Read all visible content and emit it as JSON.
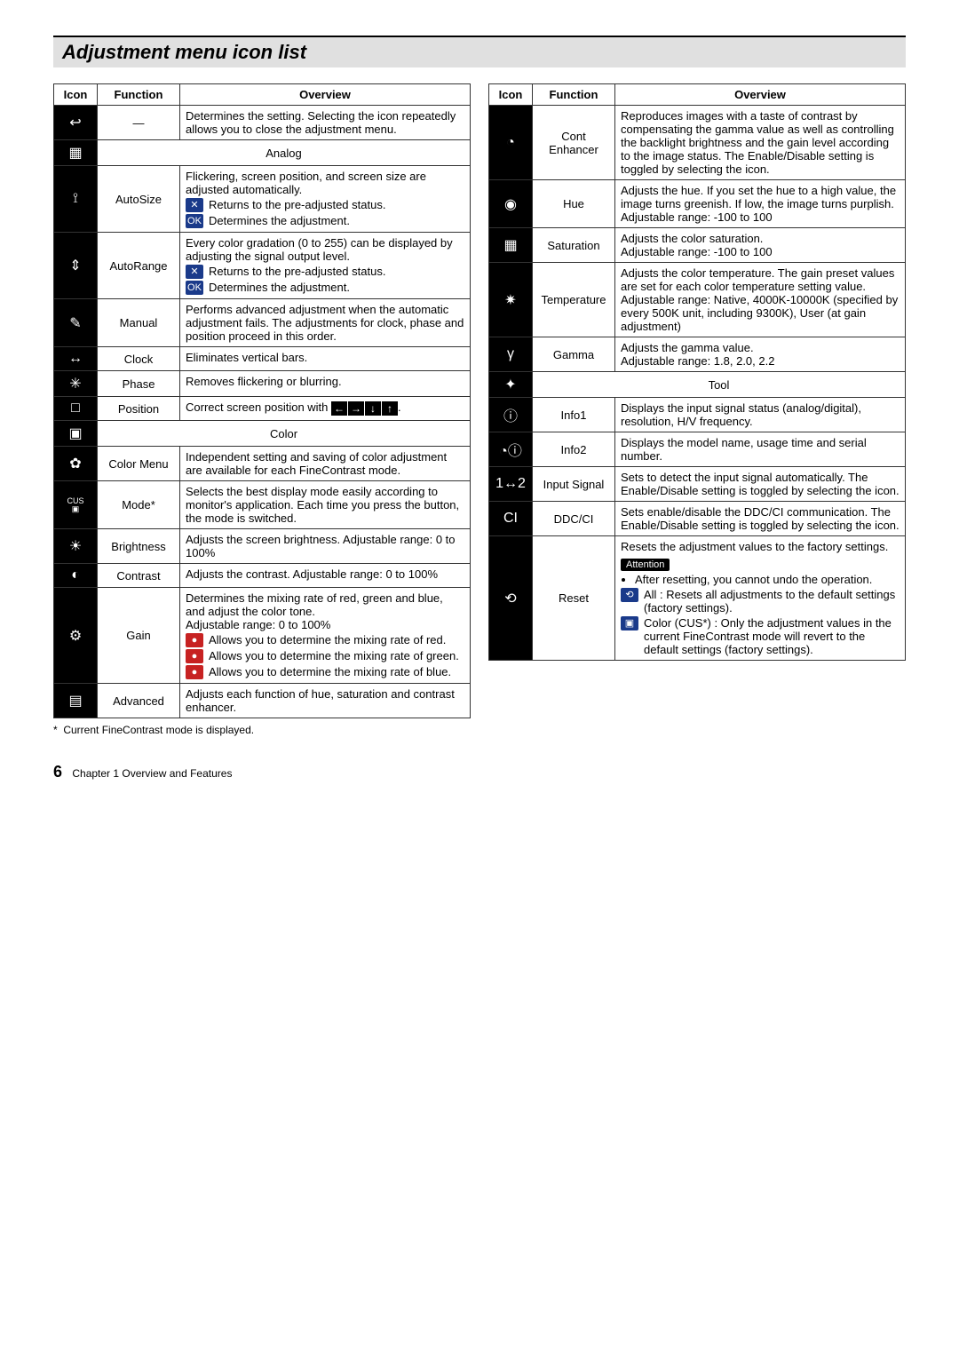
{
  "page": {
    "title": "Adjustment menu icon list",
    "footnote": "Current FineContrast mode is displayed.",
    "footer_page": "6",
    "footer_chapter": "Chapter 1  Overview and Features"
  },
  "headers": {
    "icon": "Icon",
    "function": "Function",
    "overview": "Overview"
  },
  "sections": {
    "analog": "Analog",
    "color": "Color",
    "tool": "Tool"
  },
  "left": [
    {
      "icon_glyph": "↩",
      "function": "—",
      "overview": "Determines the setting. Selecting the icon repeatedly allows you to close the adjustment menu."
    },
    {
      "section": "analog",
      "icon_glyph": "▦"
    },
    {
      "icon_glyph": "⟟",
      "function": "AutoSize",
      "overview": "Flickering, screen position, and screen size are adjusted automatically.",
      "sub": [
        {
          "icon": "✕",
          "cls": "darkblue",
          "text": "Returns to the pre-adjusted status."
        },
        {
          "icon": "OK",
          "cls": "darkblue",
          "text": "Determines the adjustment."
        }
      ]
    },
    {
      "icon_glyph": "⇕",
      "function": "AutoRange",
      "overview": "Every color gradation (0 to 255) can be displayed by adjusting the signal output level.",
      "sub": [
        {
          "icon": "✕",
          "cls": "darkblue",
          "text": "Returns to the pre-adjusted status."
        },
        {
          "icon": "OK",
          "cls": "darkblue",
          "text": "Determines the adjustment."
        }
      ]
    },
    {
      "icon_glyph": "✎",
      "function": "Manual",
      "overview": "Performs advanced adjustment when the automatic adjustment fails. The adjustments for clock, phase and position proceed in this order."
    },
    {
      "icon_glyph": "↔",
      "function": "Clock",
      "overview": "Eliminates vertical bars."
    },
    {
      "icon_glyph": "✳",
      "function": "Phase",
      "overview": "Removes flickering or blurring."
    },
    {
      "icon_glyph": "□",
      "function": "Position",
      "overview_prefix": "Correct screen position with",
      "arrows": [
        "←",
        "→",
        "↓",
        "↑"
      ]
    },
    {
      "section": "color",
      "icon_glyph": "▣"
    },
    {
      "icon_glyph": "✿",
      "function": "Color Menu",
      "overview": "Independent setting and saving of color adjustment are available for each FineContrast mode."
    },
    {
      "icon_glyph": "CUS",
      "cus": true,
      "function": "Mode*",
      "overview": "Selects the best display mode easily according to monitor's application. Each time you press the button, the mode is switched."
    },
    {
      "icon_glyph": "☀",
      "function": "Brightness",
      "overview": "Adjusts the screen brightness. Adjustable range: 0 to 100%"
    },
    {
      "icon_glyph": "◐",
      "function": "Contrast",
      "overview": "Adjusts the contrast. Adjustable range: 0 to 100%"
    },
    {
      "icon_glyph": "⚙",
      "function": "Gain",
      "overview": "Determines the mixing rate of red, green and blue, and adjust the color tone.\nAdjustable range: 0 to 100%",
      "sub": [
        {
          "icon": "●",
          "cls": "red",
          "text": "Allows you to determine the mixing rate of red."
        },
        {
          "icon": "●",
          "cls": "red",
          "text": "Allows you to determine the mixing rate of green."
        },
        {
          "icon": "●",
          "cls": "red",
          "text": "Allows you to determine the mixing rate of blue."
        }
      ]
    },
    {
      "icon_glyph": "▤",
      "function": "Advanced",
      "overview": "Adjusts each function of hue, saturation and contrast enhancer."
    }
  ],
  "right": [
    {
      "icon_glyph": "◔",
      "function": "Cont Enhancer",
      "overview": "Reproduces images with a taste of contrast by compensating the gamma value as well as controlling the backlight brightness and the gain level according to the image status. The Enable/Disable setting is toggled by selecting the icon."
    },
    {
      "icon_glyph": "◉",
      "function": "Hue",
      "overview": "Adjusts the hue. If you set the hue to a high value, the image turns greenish. If low, the image turns purplish.\nAdjustable range: -100 to 100"
    },
    {
      "icon_glyph": "▦",
      "function": "Saturation",
      "overview": "Adjusts the color saturation.\nAdjustable range: -100 to 100"
    },
    {
      "icon_glyph": "✷",
      "function": "Temperature",
      "overview": "Adjusts the color temperature. The gain preset values are set for each color temperature setting value. Adjustable range: Native, 4000K-10000K (specified by every 500K unit, including 9300K), User (at gain adjustment)"
    },
    {
      "icon_glyph": "γ",
      "function": "Gamma",
      "overview": "Adjusts the gamma value.\nAdjustable range: 1.8, 2.0, 2.2"
    },
    {
      "section": "tool",
      "icon_glyph": "✦"
    },
    {
      "icon_glyph": "ⓘ",
      "function": "Info1",
      "overview": "Displays the input signal status (analog/digital), resolution, H/V frequency."
    },
    {
      "icon_glyph": "◔ⓘ",
      "function": "Info2",
      "overview": "Displays the model name, usage time and serial number."
    },
    {
      "icon_glyph": "1↔2",
      "function": "Input Signal",
      "overview": "Sets to detect the input signal automatically. The Enable/Disable setting is toggled by selecting the icon."
    },
    {
      "icon_glyph": "CI",
      "function": "DDC/CI",
      "overview": "Sets enable/disable the DDC/CI communication. The Enable/Disable setting is toggled by selecting the icon."
    },
    {
      "icon_glyph": "⟲",
      "function": "Reset",
      "overview": "Resets the adjustment values to the factory settings.",
      "attention": "Attention",
      "attention_bullet": "After resetting, you cannot undo the operation.",
      "sub": [
        {
          "icon": "⟲",
          "cls": "darkblue",
          "text": "All : Resets all adjustments to the default settings (factory settings)."
        },
        {
          "icon": "▣",
          "cls": "darkblue",
          "text": "Color (CUS*) : Only the adjustment values in the current FineContrast mode will revert to the default settings (factory settings)."
        }
      ]
    }
  ]
}
